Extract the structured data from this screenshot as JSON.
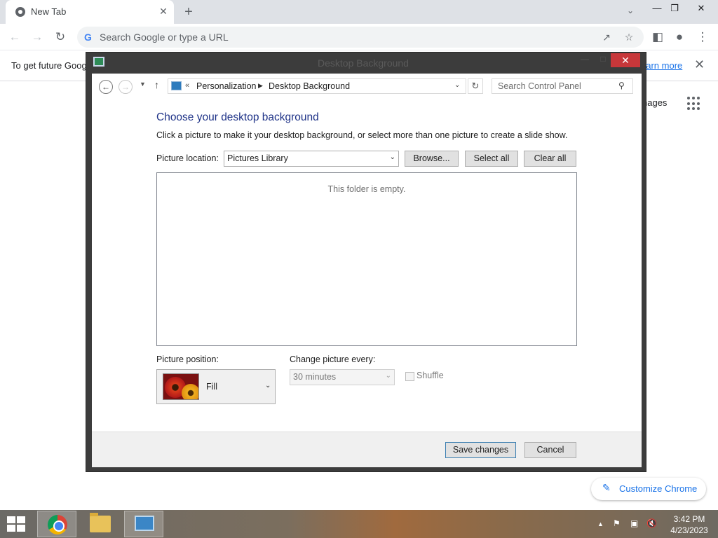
{
  "browser": {
    "tab_title": "New Tab",
    "tab_close": "✕",
    "new_tab": "+",
    "omnibox_placeholder": "Search Google or type a URL",
    "infobar_text": "To get future Goog",
    "infobar_link": "earn more",
    "ntp_link_images": "nages",
    "customize_label": "Customize Chrome"
  },
  "dialog": {
    "title": "Desktop Background",
    "breadcrumb": [
      "Personalization",
      "Desktop Background"
    ],
    "breadcrumb_overflow": "«",
    "search_placeholder": "Search Control Panel",
    "heading": "Choose your desktop background",
    "description": "Click a picture to make it your desktop background, or select more than one picture to create a slide show.",
    "picture_location_label": "Picture location:",
    "picture_location_value": "Pictures Library",
    "browse_label": "Browse...",
    "select_all_label": "Select all",
    "clear_all_label": "Clear all",
    "empty_message": "This folder is empty.",
    "picture_position_label": "Picture position:",
    "picture_position_value": "Fill",
    "change_every_label": "Change picture every:",
    "change_every_value": "30 minutes",
    "shuffle_label": "Shuffle",
    "shuffle_checked": false,
    "save_label": "Save changes",
    "cancel_label": "Cancel"
  },
  "taskbar": {
    "time": "3:42 PM",
    "date": "4/23/2023"
  },
  "colors": {
    "dialog_heading": "#1e3287",
    "close_button": "#c7373a",
    "chrome_link": "#1a73e8"
  }
}
